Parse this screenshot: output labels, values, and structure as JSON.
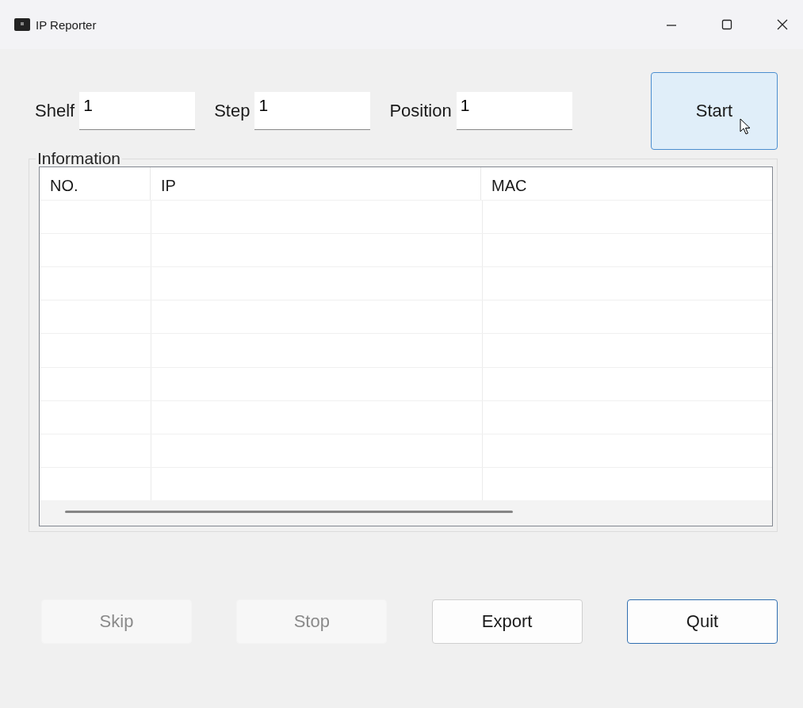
{
  "window": {
    "title": "IP Reporter"
  },
  "fields": [
    {
      "label": "Shelf",
      "value": "1"
    },
    {
      "label": "Step",
      "value": "1"
    },
    {
      "label": "Position",
      "value": "1"
    }
  ],
  "start_button": {
    "label": "Start",
    "hovered": true
  },
  "group": {
    "title": "Information"
  },
  "table": {
    "columns": [
      "NO.",
      "IP",
      "MAC"
    ]
  },
  "buttons": [
    {
      "label": "Skip",
      "disabled": true,
      "default": false
    },
    {
      "label": "Stop",
      "disabled": true,
      "default": false
    },
    {
      "label": "Export",
      "disabled": false,
      "default": false
    },
    {
      "label": "Quit",
      "disabled": false,
      "default": true
    }
  ]
}
